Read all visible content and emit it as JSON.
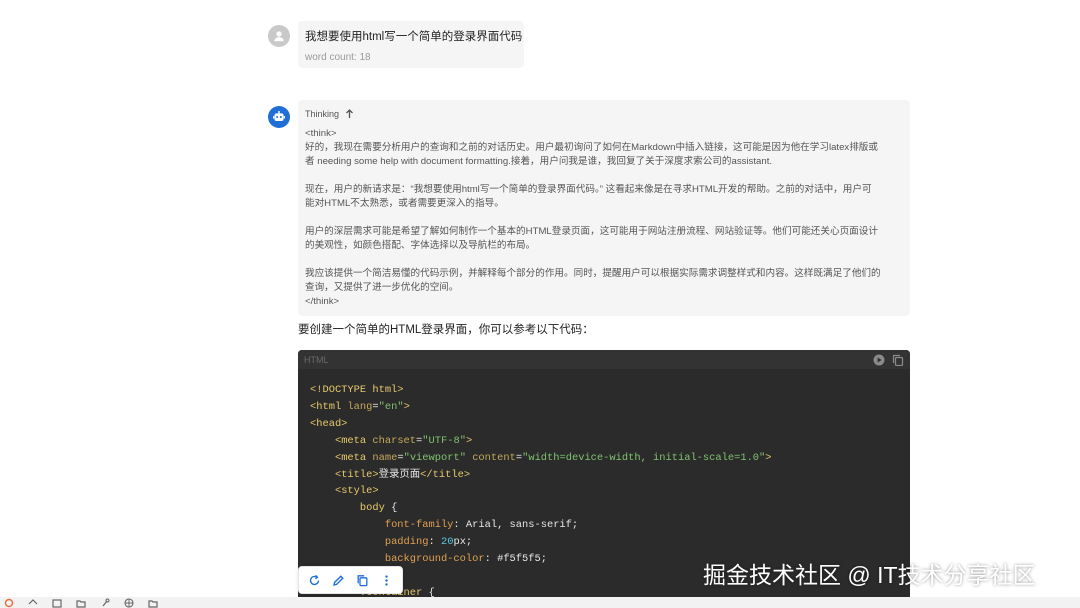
{
  "user_message": {
    "text": "我想要使用html写一个简单的登录界面代码",
    "word_count": "word count: 18"
  },
  "thinking": {
    "label": "Thinking",
    "lines": [
      "<think>",
      "好的，我现在需要分析用户的查询和之前的对话历史。用户最初询问了如何在Markdown中插入链接，这可能是因为他在学习latex排版或",
      "者 needing some help with document formatting.接着，用户问我是谁，我回复了关于深度求索公司的assistant.",
      "",
      "现在，用户的新请求是：“我想要使用html写一个简单的登录界面代码。” 这看起来像是在寻求HTML开发的帮助。之前的对话中，用户可",
      "能对HTML不太熟悉，或者需要更深入的指导。",
      "",
      "用户的深层需求可能是希望了解如何制作一个基本的HTML登录页面，这可能用于网站注册流程、网站验证等。他们可能还关心页面设计",
      "的美观性，如颜色搭配、字体选择以及导航栏的布局。",
      "",
      "我应该提供一个简洁易懂的代码示例，并解释每个部分的作用。同时，提醒用户可以根据实际需求调整样式和内容。这样既满足了他们的",
      "查询，又提供了进一步优化的空间。",
      "</think>"
    ]
  },
  "answer": {
    "intro": "要创建一个简单的HTML登录界面，你可以参考以下代码："
  },
  "code": {
    "lang": "HTML",
    "lines": [
      [
        [
          "tag",
          "<!DOCTYPE html>"
        ]
      ],
      [
        [
          "tag",
          "<html "
        ],
        [
          "attr",
          "lang"
        ],
        [
          "txt",
          "="
        ],
        [
          "str",
          "\"en\""
        ],
        [
          "tag",
          ">"
        ]
      ],
      [
        [
          "tag",
          "<head>"
        ]
      ],
      [
        [
          "txt",
          "    "
        ],
        [
          "tag",
          "<meta "
        ],
        [
          "attr",
          "charset"
        ],
        [
          "txt",
          "="
        ],
        [
          "str",
          "\"UTF-8\""
        ],
        [
          "tag",
          ">"
        ]
      ],
      [
        [
          "txt",
          "    "
        ],
        [
          "tag",
          "<meta "
        ],
        [
          "attr",
          "name"
        ],
        [
          "txt",
          "="
        ],
        [
          "str",
          "\"viewport\""
        ],
        [
          "txt",
          " "
        ],
        [
          "attr",
          "content"
        ],
        [
          "txt",
          "="
        ],
        [
          "str",
          "\"width=device-width, initial-scale=1.0\""
        ],
        [
          "tag",
          ">"
        ]
      ],
      [
        [
          "txt",
          "    "
        ],
        [
          "tag",
          "<title>"
        ],
        [
          "txt",
          "登录页面"
        ],
        [
          "tag",
          "</title>"
        ]
      ],
      [
        [
          "txt",
          "    "
        ],
        [
          "tag",
          "<style>"
        ]
      ],
      [
        [
          "txt",
          "        "
        ],
        [
          "tag",
          "body"
        ],
        [
          "txt",
          " {"
        ]
      ],
      [
        [
          "txt",
          "            "
        ],
        [
          "prop",
          "font-family"
        ],
        [
          "txt",
          ": Arial, sans-serif;"
        ]
      ],
      [
        [
          "txt",
          "            "
        ],
        [
          "prop",
          "padding"
        ],
        [
          "txt",
          ": "
        ],
        [
          "num",
          "20"
        ],
        [
          "txt",
          "px;"
        ]
      ],
      [
        [
          "txt",
          "            "
        ],
        [
          "prop",
          "background-color"
        ],
        [
          "txt",
          ": #f5f5f5;"
        ]
      ],
      [
        [
          "txt",
          "        }"
        ]
      ],
      [
        [
          "txt",
          "        "
        ],
        [
          "tag",
          ".container"
        ],
        [
          "txt",
          " {"
        ]
      ]
    ]
  },
  "watermark": "掘金技术社区 @ IT技术分享社区",
  "colors": {
    "bot_avatar": "#1f6fd6",
    "code_bg": "#2b2b2b",
    "bubble_bg": "#f5f5f5"
  },
  "icons": {
    "user_avatar": "person-icon",
    "bot_avatar": "robot-icon",
    "thinking_toggle": "arrow-up-icon",
    "code_run": "play-icon",
    "code_copy": "copy-icon",
    "actions": [
      "refresh-icon",
      "edit-icon",
      "copy-icon",
      "more-vertical-icon"
    ]
  }
}
